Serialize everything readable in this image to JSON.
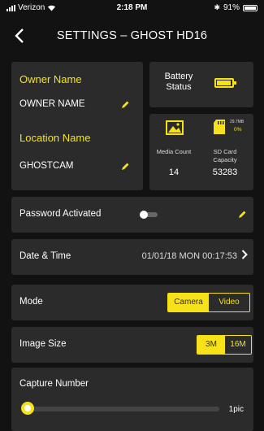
{
  "status_bar": {
    "carrier": "Verizon",
    "time": "2:18 PM",
    "battery_percent": "91%"
  },
  "header": {
    "back_icon": "chevron-left-icon",
    "title": "SETTINGS – GHOST HD16"
  },
  "owner": {
    "label": "Owner Name",
    "value": "OWNER NAME"
  },
  "location": {
    "label": "Location Name",
    "value": "GHOSTCAM"
  },
  "battery": {
    "label": "Battery Status",
    "level": 0.9,
    "icon": "battery-icon"
  },
  "stats": {
    "media_label": "Media Count",
    "media_value": "14",
    "sd_label": "SD Card Capacity",
    "sd_value": "53283",
    "sd_capacity_small": "29.7MB",
    "sd_percent": "0%",
    "media_icon": "image-icon",
    "sd_icon": "sd-card-icon"
  },
  "password": {
    "label": "Password Activated",
    "enabled": false
  },
  "datetime": {
    "label": "Date & Time",
    "value": "01/01/18 MON 00:17:53"
  },
  "mode": {
    "label": "Mode",
    "options": [
      "Camera",
      "Video"
    ],
    "selected": "Camera"
  },
  "image_size": {
    "label": "Image Size",
    "options": [
      "3M",
      "16M"
    ],
    "selected": "3M"
  },
  "capture": {
    "label": "Capture Number",
    "value": "1pic",
    "level": 0
  },
  "colors": {
    "accent": "#f7e21a",
    "card": "#2b2b2b",
    "background": "#121212"
  }
}
